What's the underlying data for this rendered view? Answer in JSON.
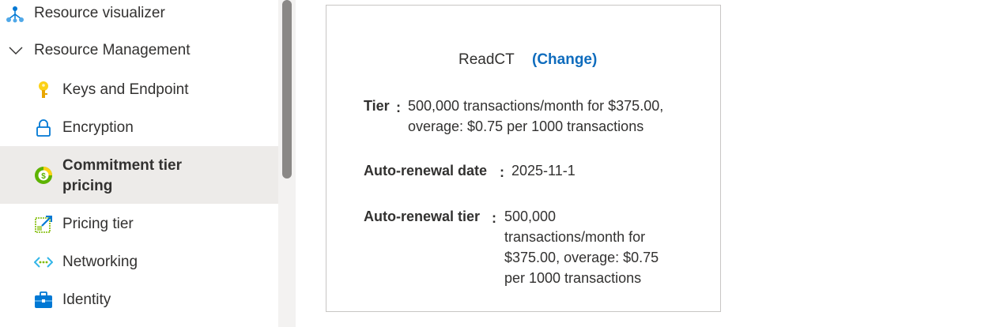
{
  "sidebar": {
    "top_item": {
      "label": "Resource visualizer",
      "icon": "resource-visualizer-icon"
    },
    "group": {
      "label": "Resource Management",
      "icon": "chevron-down-icon",
      "expanded": true
    },
    "items": [
      {
        "label": "Keys and Endpoint",
        "icon": "key-icon",
        "selected": false
      },
      {
        "label": "Encryption",
        "icon": "lock-icon",
        "selected": false
      },
      {
        "label": "Commitment tier pricing",
        "icon": "commitment-tier-icon",
        "selected": true
      },
      {
        "label": "Pricing tier",
        "icon": "edit-pricing-icon",
        "selected": false
      },
      {
        "label": "Networking",
        "icon": "networking-icon",
        "selected": false
      },
      {
        "label": "Identity",
        "icon": "identity-icon",
        "selected": false
      }
    ]
  },
  "card": {
    "title": "ReadCT",
    "change_label": "(Change)",
    "tier_label": "Tier",
    "tier_value": "500,000 transactions/month for $375.00, overage: $0.75 per 1000 transactions",
    "renewal_date_label": "Auto-renewal date",
    "renewal_date_value": "2025-11-1",
    "renewal_tier_label": "Auto-renewal tier",
    "renewal_tier_value": "500,000 transactions/month for $375.00, overage: $0.75 per 1000 transactions",
    "colon": ":"
  },
  "colors": {
    "accent": "#0f6cbd",
    "selected_bg": "#edebe9",
    "scrollbar_thumb": "#8a8886"
  }
}
